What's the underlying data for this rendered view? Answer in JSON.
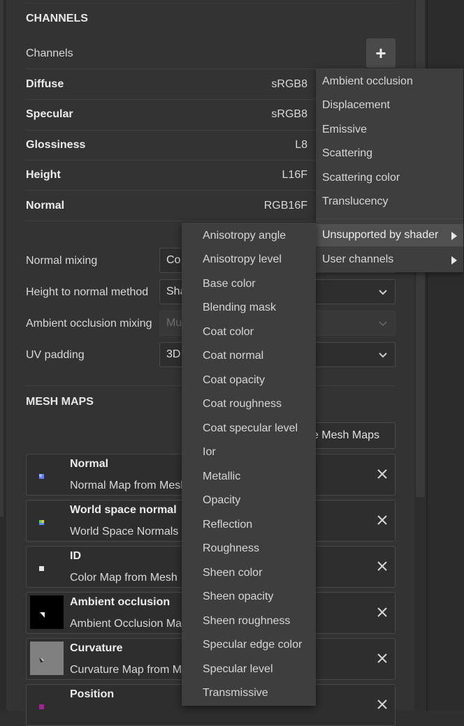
{
  "channels_section": {
    "title": "CHANNELS",
    "channels_label": "Channels",
    "add_label": "+",
    "rows": [
      {
        "name": "Diffuse",
        "format": "sRGB8"
      },
      {
        "name": "Specular",
        "format": "sRGB8"
      },
      {
        "name": "Glossiness",
        "format": "L8"
      },
      {
        "name": "Height",
        "format": "L16F"
      },
      {
        "name": "Normal",
        "format": "RGB16F"
      }
    ]
  },
  "settings": {
    "normal_mixing": {
      "label": "Normal mixing",
      "value": "Co"
    },
    "height_to_normal": {
      "label": "Height to normal method",
      "value": "Sha"
    },
    "ao_mixing": {
      "label": "Ambient occlusion mixing",
      "value": "Mu"
    },
    "uv_padding": {
      "label": "UV padding",
      "value": "3D"
    }
  },
  "mesh_maps": {
    "title": "MESH MAPS",
    "bake_button": "Bake Mesh Maps",
    "items": [
      {
        "name": "Normal",
        "desc": "Normal Map from Mesh"
      },
      {
        "name": "World space normal",
        "desc": "World Space Normals"
      },
      {
        "name": "ID",
        "desc": "Color Map from Mesh"
      },
      {
        "name": "Ambient occlusion",
        "desc": "Ambient Occlusion Map 1"
      },
      {
        "name": "Curvature",
        "desc": "Curvature Map from Mesh"
      },
      {
        "name": "Position",
        "desc": ""
      }
    ]
  },
  "add_channel_menu": {
    "items": [
      "Ambient occlusion",
      "Displacement",
      "Emissive",
      "Scattering",
      "Scattering color",
      "Translucency"
    ],
    "submenus": [
      "Unsupported by shader",
      "User channels"
    ]
  },
  "unsupported_submenu": {
    "items": [
      "Anisotropy angle",
      "Anisotropy level",
      "Base color",
      "Blending mask",
      "Coat color",
      "Coat normal",
      "Coat opacity",
      "Coat roughness",
      "Coat specular level",
      "Ior",
      "Metallic",
      "Opacity",
      "Reflection",
      "Roughness",
      "Sheen color",
      "Sheen opacity",
      "Sheen roughness",
      "Specular edge color",
      "Specular level",
      "Transmissive"
    ]
  },
  "colors": {
    "panel_bg": "#333333",
    "menu_bg": "#3e3e3e",
    "menu_highlight": "#505050",
    "text": "#dcdcdc"
  }
}
